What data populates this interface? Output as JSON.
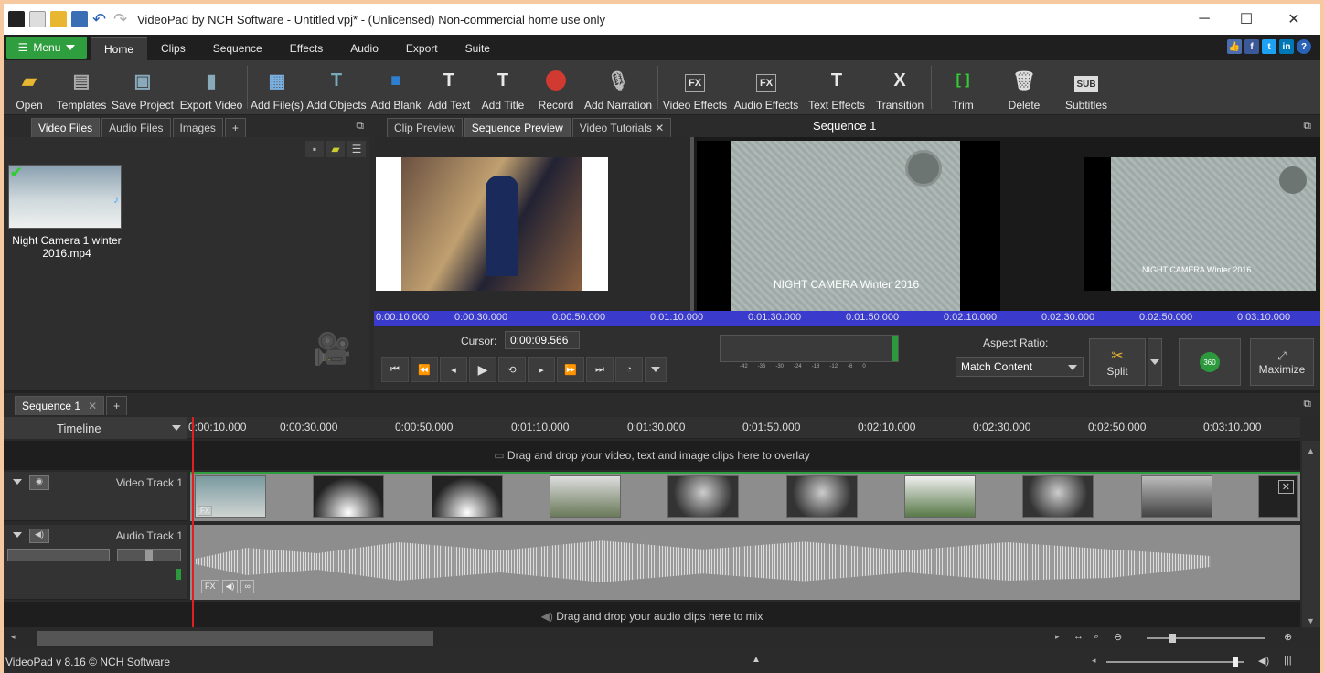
{
  "window": {
    "title": "VideoPad by NCH Software - Untitled.vpj* - (Unlicensed) Non-commercial home use only",
    "minimize": "─",
    "maximize": "☐",
    "close": "✕"
  },
  "menubar": {
    "menu_label": "Menu",
    "tabs": [
      "Home",
      "Clips",
      "Sequence",
      "Effects",
      "Audio",
      "Export",
      "Suite"
    ]
  },
  "toolbar": {
    "items": [
      "Open",
      "Templates",
      "Save Project",
      "Export Video",
      "Add File(s)",
      "Add Objects",
      "Add Blank",
      "Add Text",
      "Add Title",
      "Record",
      "Add Narration",
      "Video Effects",
      "Audio Effects",
      "Text Effects",
      "Transition",
      "Trim",
      "Delete",
      "Subtitles"
    ]
  },
  "bin": {
    "tabs": [
      "Video Files",
      "Audio Files",
      "Images",
      "+"
    ],
    "clip_name": "Night Camera 1 winter 2016.mp4"
  },
  "preview": {
    "tabs": [
      "Clip Preview",
      "Sequence Preview",
      "Video Tutorials ✕"
    ],
    "title": "Sequence 1",
    "overlay_text": "NIGHT CAMERA Winter 2016",
    "overlay_text_small": "NIGHT CAMERA Winter 2016",
    "ruler": [
      "0:00:10.000",
      "0:00:30.000",
      "0:00:50.000",
      "0:01:10.000",
      "0:01:30.000",
      "0:01:50.000",
      "0:02:10.000",
      "0:02:30.000",
      "0:02:50.000",
      "0:03:10.000"
    ]
  },
  "controls": {
    "cursor_label": "Cursor:",
    "cursor_value": "0:00:09.566",
    "aspect_label": "Aspect Ratio:",
    "aspect_value": "Match Content",
    "split": "Split",
    "maximize": "Maximize",
    "btn_360": "360",
    "vu_ticks": [
      "-42",
      "-36",
      "-30",
      "-24",
      "-18",
      "-12",
      "-6",
      "0"
    ]
  },
  "sequence": {
    "tab": "Sequence 1",
    "timeline_label": "Timeline",
    "ruler": [
      "0:00:10.000",
      "0:00:30.000",
      "0:00:50.000",
      "0:01:10.000",
      "0:01:30.000",
      "0:01:50.000",
      "0:02:10.000",
      "0:02:30.000",
      "0:02:50.000",
      "0:03:10.000"
    ],
    "overlay_hint": "Drag and drop your video, text and image clips here to overlay",
    "video_track": "Video Track 1",
    "audio_track": "Audio Track 1",
    "mix_hint": "Drag and drop your audio clips here to mix",
    "fx": "FX"
  },
  "status": {
    "version": "VideoPad v 8.16 © NCH Software"
  }
}
